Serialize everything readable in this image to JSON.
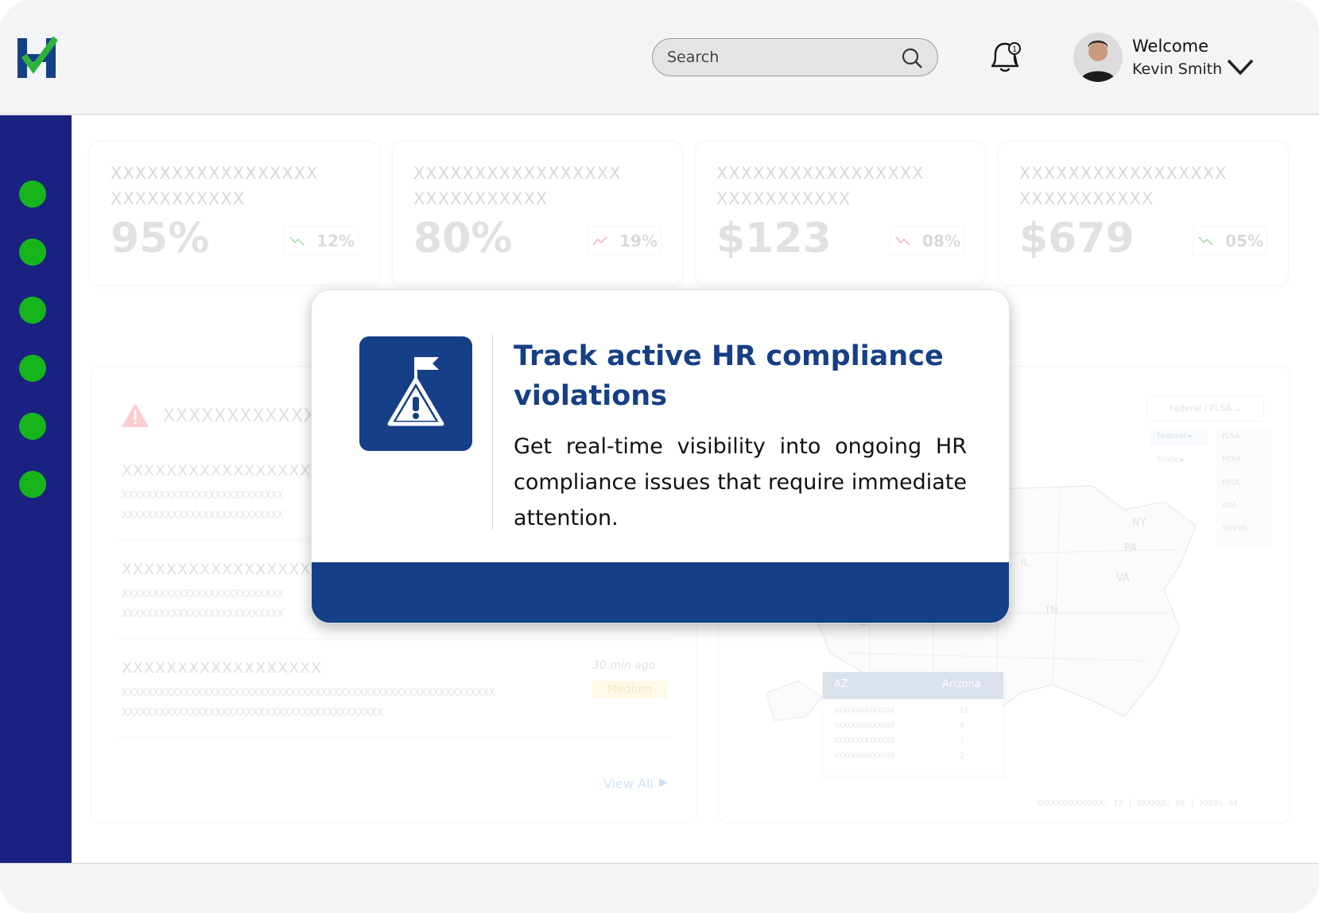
{
  "header": {
    "search_placeholder": "Search",
    "welcome": "Welcome",
    "user_name": "Kevin Smith",
    "notification_count": "1"
  },
  "sidebar": {
    "items": [
      {
        "icon": "nav-dot-icon",
        "color": "#17b51c"
      },
      {
        "icon": "nav-dot-icon",
        "color": "#17b51c"
      },
      {
        "icon": "nav-dot-icon",
        "color": "#17b51c"
      },
      {
        "icon": "nav-dot-icon",
        "color": "#17b51c"
      },
      {
        "icon": "nav-dot-icon",
        "color": "#17b51c"
      },
      {
        "icon": "nav-dot-icon",
        "color": "#17b51c"
      }
    ]
  },
  "stats": [
    {
      "line1": "XXXXXXXXXXXXXXXXX",
      "line2": "XXXXXXXXXXX",
      "value": "95%",
      "change": "12%",
      "trend": "down"
    },
    {
      "line1": "XXXXXXXXXXXXXXXXX",
      "line2": "XXXXXXXXXXX",
      "value": "80%",
      "change": "19%",
      "trend": "up"
    },
    {
      "line1": "XXXXXXXXXXXXXXXXX",
      "line2": "XXXXXXXXXXX",
      "value": "$123",
      "change": "08%",
      "trend": "down"
    },
    {
      "line1": "XXXXXXXXXXXXXXXXX",
      "line2": "XXXXXXXXXXX",
      "value": "$679",
      "change": "05%",
      "trend": "down"
    }
  ],
  "violations_panel": {
    "title": "XXXXXXXXXXXX",
    "items": [
      {
        "title": "XXXXXXXXXXXXXXXXXX",
        "sub1": "XXXXXXXXXXXXXXXXXXXXXXXXXX",
        "sub2": "XXXXXXXXXXXXXXXXXXXXXXXXXX"
      },
      {
        "title": "XXXXXXXXXXXXXXXXXX",
        "sub1": "XXXXXXXXXXXXXXXXXXXXXXXXXX",
        "sub2": "XXXXXXXXXXXXXXXXXXXXXXXXXX"
      },
      {
        "title": "XXXXXXXXXXXXXXXXXX",
        "sub1": "XXXXXXXXXXXXXXXXXXXXXXXXXXXXXXXXXXXXXXXXXXXXXXXXXXXXXXXXXXXX",
        "sub2": "XXXXXXXXXXXXXXXXXXXXXXXXXXXXXXXXXXXXXXXXXX",
        "time": "30 min ago",
        "severity": "Medium"
      }
    ],
    "view_all": "View All"
  },
  "map_panel": {
    "filter": "Federal / FLSA",
    "menu_left": [
      "Federal",
      "State"
    ],
    "menu_right": [
      "FLSA",
      "FCRA",
      "EEOC",
      "ADA",
      "TitleVII"
    ],
    "state_labels": [
      "NY",
      "PA",
      "VA",
      "IL",
      "TN",
      "OK",
      "AZ"
    ],
    "tooltip": {
      "code": "AZ",
      "name": "Arizona",
      "rows": [
        {
          "label": "XXXXXXXXXXXXXX",
          "value": "13"
        },
        {
          "label": "XXXXXXXXXXXXXX",
          "value": "4"
        },
        {
          "label": "XXXXXXXXXXXXXX",
          "value": "7"
        },
        {
          "label": "XXXXXXXXXXXXXX",
          "value": "2"
        }
      ]
    },
    "legend": "XXXXXXXXXXXXXX: 13 | XXXXXX: 09 | XXXX: 04"
  },
  "modal": {
    "title": "Track active HR compliance violations",
    "body": "Get real-time visibility into ongoing HR compliance issues that require immediate attention.",
    "icon": "flag-warning-icon",
    "accent": "#153f86"
  }
}
